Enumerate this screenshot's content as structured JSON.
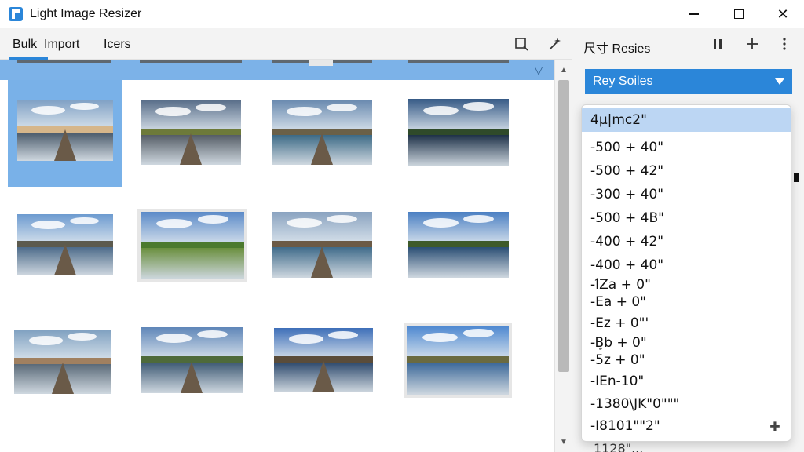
{
  "window": {
    "title": "Light Image Resizer",
    "minimize_icon": "minimize-icon",
    "maximize_icon": "maximize-icon",
    "close_icon": "close-icon"
  },
  "toolbar": {
    "tabs": [
      {
        "label": "Bulk",
        "active": true
      },
      {
        "label": "Import",
        "active": false
      },
      {
        "label": "Icers",
        "active": false
      }
    ],
    "icons": [
      "crop-icon",
      "magic-wand-icon"
    ]
  },
  "right_panel": {
    "title": "尺寸 Resies",
    "icons": [
      "pause-icon",
      "add-icon",
      "more-vertical-icon"
    ],
    "preset_select": {
      "value": "Rey Soiles"
    },
    "dropdown": {
      "items": [
        "4µ|mc2\"",
        "-500 + 40\"",
        "-500 + 42\"",
        "-300 + 40\"",
        "-500 + 4B\"",
        "-400 + 42\"",
        "-400 + 40\"",
        "-Ӏ́Za + 0\"",
        "-Ea + 0\"",
        "-Ez + 0\"'",
        "-B̧b + 0\"",
        "-5z + 0\"",
        "-ӀEn-10\"",
        "-1380\\JK\"0\"\"\"",
        "-I8101\"\"2\""
      ],
      "selected_index": 0,
      "overflow_text": "1128\"..."
    }
  },
  "colors": {
    "accent": "#2b86d9",
    "selection": "#79b1e8",
    "dropdown_selected": "#bcd6f3",
    "panel_bg": "#f3f3f3"
  },
  "gallery": {
    "selected_index": 0,
    "thumbnails": [
      {
        "scene": "lake-pier-dusk"
      },
      {
        "scene": "grass-path-cloudy"
      },
      {
        "scene": "pier-cloudy-lake"
      },
      {
        "scene": "forest-lake-reflection"
      },
      {
        "scene": "pier-cloudy-blue"
      },
      {
        "scene": "meadow-cloudy"
      },
      {
        "scene": "pier-dusk-calm"
      },
      {
        "scene": "mountain-lake-reflection"
      },
      {
        "scene": "pier-sunset-lake"
      },
      {
        "scene": "pier-hills-cloudy"
      },
      {
        "scene": "pier-blue-sky-clouds"
      },
      {
        "scene": "lake-hills-reflection"
      }
    ]
  }
}
